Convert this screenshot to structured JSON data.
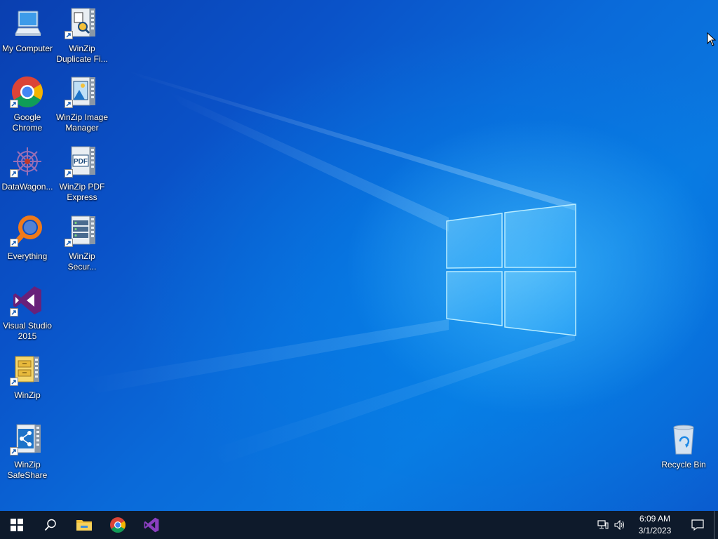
{
  "desktop": {
    "icons": [
      {
        "label": "My Computer",
        "icon": "computer-icon"
      },
      {
        "label": "WinZip Duplicate Fi...",
        "icon": "winzip-duplicate-icon"
      },
      {
        "label": "Google Chrome",
        "icon": "chrome-icon"
      },
      {
        "label": "WinZip Image Manager",
        "icon": "winzip-image-icon"
      },
      {
        "label": "DataWagon...",
        "icon": "datawagon-icon"
      },
      {
        "label": "WinZip PDF Express",
        "icon": "winzip-pdf-icon"
      },
      {
        "label": "Everything",
        "icon": "everything-icon"
      },
      {
        "label": "WinZip Secur...",
        "icon": "winzip-secure-icon"
      },
      {
        "label": "Visual Studio 2015",
        "icon": "visual-studio-icon"
      },
      {
        "label": "WinZip",
        "icon": "winzip-icon"
      },
      {
        "label": "WinZip SafeShare",
        "icon": "winzip-safeshare-icon"
      },
      {
        "label": "Recycle Bin",
        "icon": "recycle-bin-icon"
      }
    ],
    "pdf_badge": "PDF"
  },
  "taskbar": {
    "items": [
      "start-icon",
      "search-icon",
      "file-explorer-icon",
      "chrome-icon",
      "visual-studio-icon"
    ],
    "clock": {
      "time": "6:09 AM",
      "date": "3/1/2023"
    },
    "tray_icons": [
      "network-icon",
      "volume-icon",
      "notification-icon"
    ]
  },
  "colors": {
    "wallpaper": "#0a6ad9",
    "taskbar": "#0e1a2b",
    "accent": "#76b9ed"
  }
}
